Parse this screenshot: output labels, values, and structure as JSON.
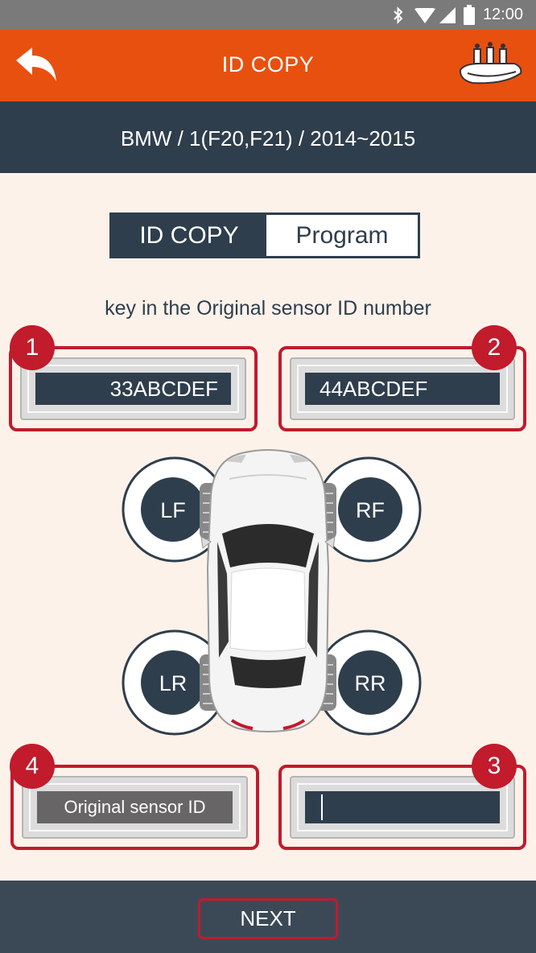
{
  "status_bar": {
    "time": "12:00"
  },
  "header": {
    "title": "ID COPY"
  },
  "vehicle": {
    "text": "BMW / 1(F20,F21) / 2014~2015"
  },
  "tabs": [
    {
      "label": "ID COPY",
      "active": true
    },
    {
      "label": "Program",
      "active": false
    }
  ],
  "instruction": "key in the Original sensor ID number",
  "sensors": {
    "box1": {
      "badge": "1",
      "value": "33ABCDEF"
    },
    "box2": {
      "badge": "2",
      "value": "44ABCDEF"
    },
    "box3": {
      "badge": "3",
      "value": ""
    },
    "box4": {
      "badge": "4",
      "value": "Original sensor ID"
    }
  },
  "wheels": {
    "lf": "LF",
    "rf": "RF",
    "lr": "LR",
    "rr": "RR"
  },
  "footer": {
    "next_label": "NEXT"
  },
  "colors": {
    "header": "#e8500f",
    "navy": "#2f3e4c",
    "accent_red": "#c11b2c",
    "background": "#fdf2ea"
  }
}
